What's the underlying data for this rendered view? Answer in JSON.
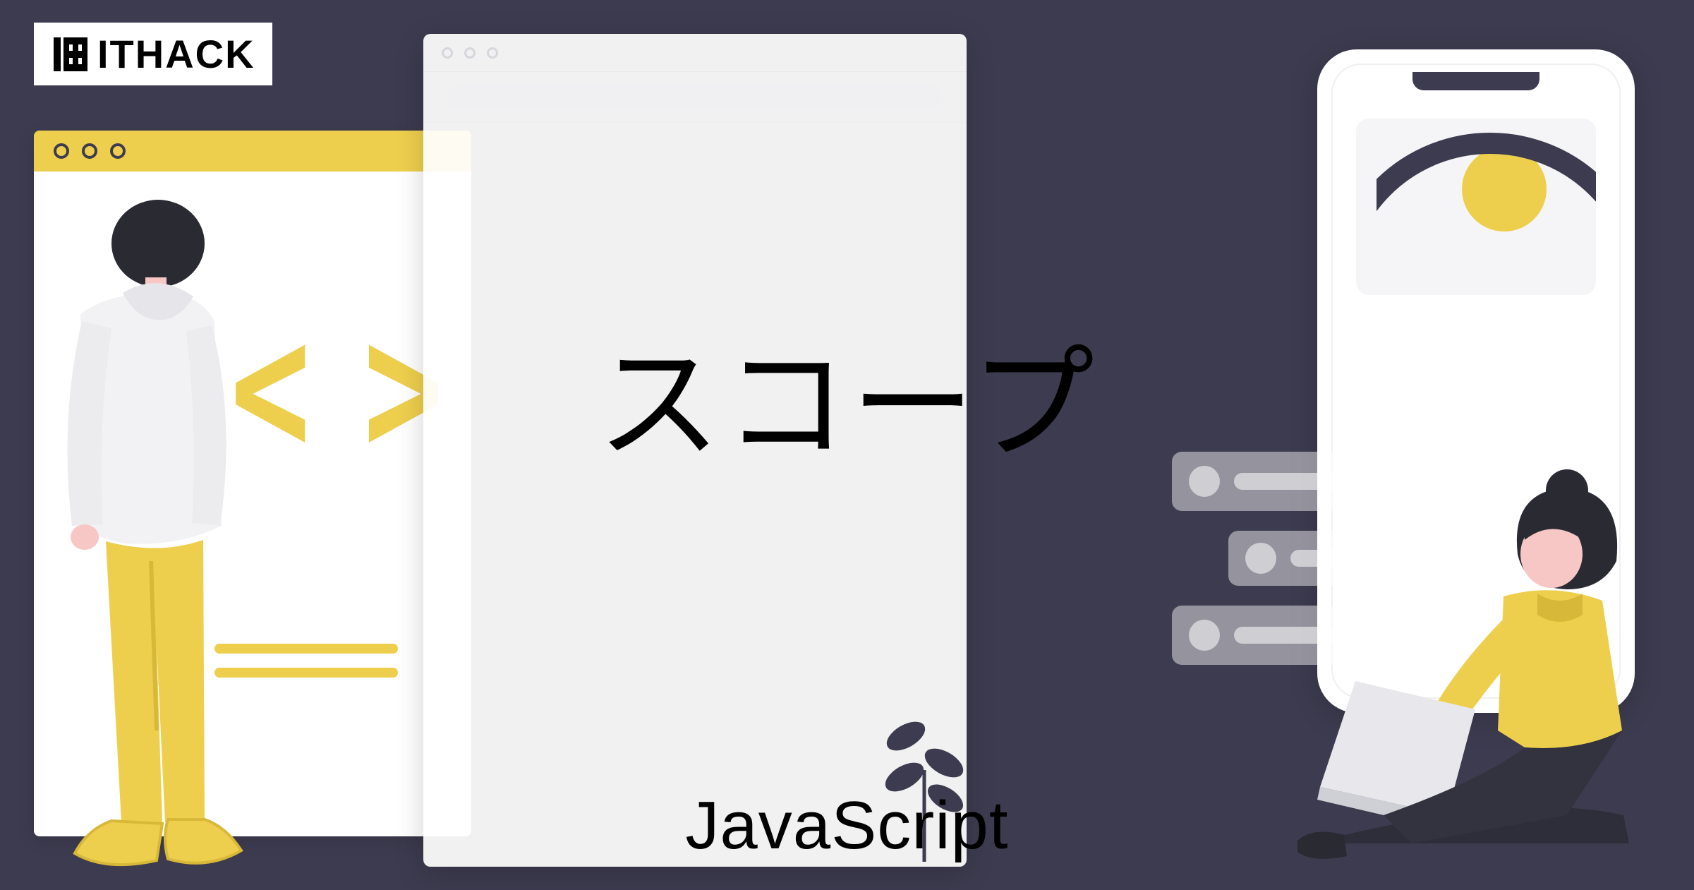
{
  "logo": {
    "text": "ITHACK"
  },
  "title": {
    "main": "スコープ",
    "sub": "JavaScript"
  },
  "code_glyph": "< >",
  "colors": {
    "background": "#3d3b4f",
    "accent": "#eecf4d",
    "white": "#ffffff",
    "skin": "#f6c7c5",
    "hair": "#2a2a33"
  }
}
